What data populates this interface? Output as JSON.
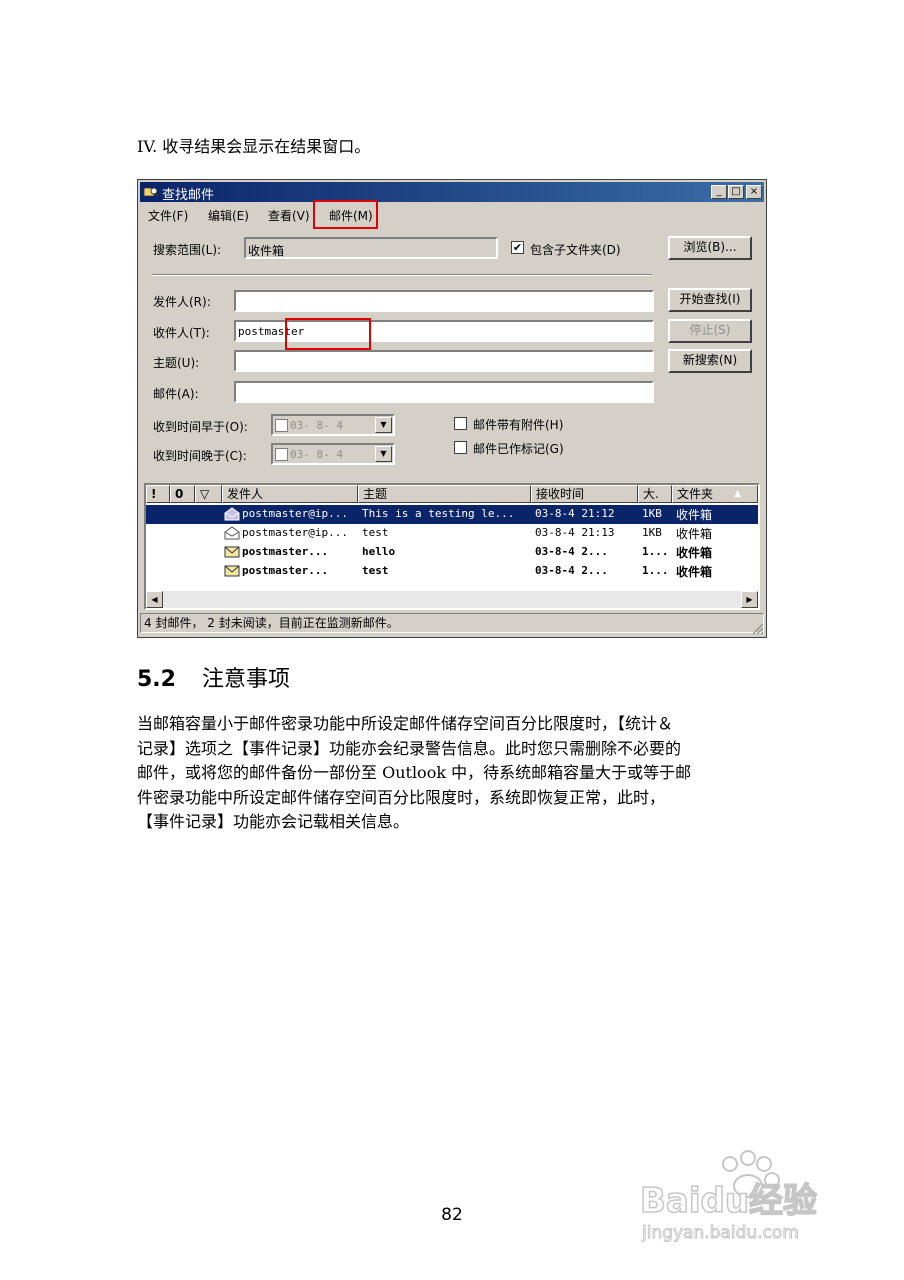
{
  "step_text": "IV.  收寻结果会显示在结果窗口。",
  "window": {
    "title": "查找邮件",
    "controls": [
      "_",
      "□",
      "×"
    ],
    "menu": [
      "文件(F)",
      "编辑(E)",
      "查看(V)",
      "邮件(M)"
    ],
    "search_scope_label": "搜索范围(L):",
    "search_scope_value": "收件箱",
    "include_subfolders_label": "包含子文件夹(D)",
    "include_subfolders_checked": true,
    "browse_button": "浏览(B)...",
    "from_label": "发件人(R):",
    "from_value": "",
    "to_label": "收件人(T):",
    "to_value": "postmaster",
    "subject_label": "主题(U):",
    "subject_value": "",
    "body_label": "邮件(A):",
    "body_value": "",
    "find_now_button": "开始查找(I)",
    "stop_button": "停止(S)",
    "new_search_button": "新搜索(N)",
    "received_before_label": "收到时间早于(O):",
    "received_before_value": "03- 8- 4",
    "received_after_label": "收到时间晚于(C):",
    "received_after_value": "03- 8- 4",
    "has_attachment_label": "邮件带有附件(H)",
    "has_attachment_checked": false,
    "flagged_label": "邮件已作标记(G)",
    "flagged_checked": false,
    "columns": [
      "!",
      "0",
      "▽",
      "发件人",
      "主题",
      "接收时间",
      "大.",
      "文件夹"
    ],
    "rows": [
      {
        "from": "postmaster@ip...",
        "subject": "This is a testing le...",
        "received": "03-8-4 21:12",
        "size": "1KB",
        "folder": "收件箱",
        "selected": true,
        "unread": false
      },
      {
        "from": "postmaster@ip...",
        "subject": "test",
        "received": "03-8-4 21:13",
        "size": "1KB",
        "folder": "收件箱",
        "selected": false,
        "unread": false
      },
      {
        "from": "postmaster...",
        "subject": "hello",
        "received": "03-8-4 2...",
        "size": "1...",
        "folder": "收件箱",
        "selected": false,
        "unread": true
      },
      {
        "from": "postmaster...",
        "subject": "test",
        "received": "03-8-4 2...",
        "size": "1...",
        "folder": "收件箱",
        "selected": false,
        "unread": true
      }
    ],
    "status_text": "4 封邮件， 2 封未阅读，目前正在监测新邮件。"
  },
  "section": {
    "number": "5.2",
    "title": "注意事项",
    "paragraph_lines": [
      "当邮箱容量小于邮件密录功能中所设定邮件储存空间百分比限度时，【统计＆",
      "记录】选项之【事件记录】功能亦会纪录警告信息。此时您只需删除不必要的",
      "邮件，或将您的邮件备份一部份至 Outlook 中，待系统邮箱容量大于或等于邮",
      "件密录功能中所设定邮件储存空间百分比限度时，系统即恢复正常，此时，",
      "【事件记录】功能亦会记载相关信息。"
    ]
  },
  "page_number": "82",
  "watermark": {
    "text": "Baidu经验",
    "url_text": "jingyan.baidu.com"
  },
  "colors": {
    "highlight": "#0a246a",
    "annotation_box": "#e00000"
  }
}
